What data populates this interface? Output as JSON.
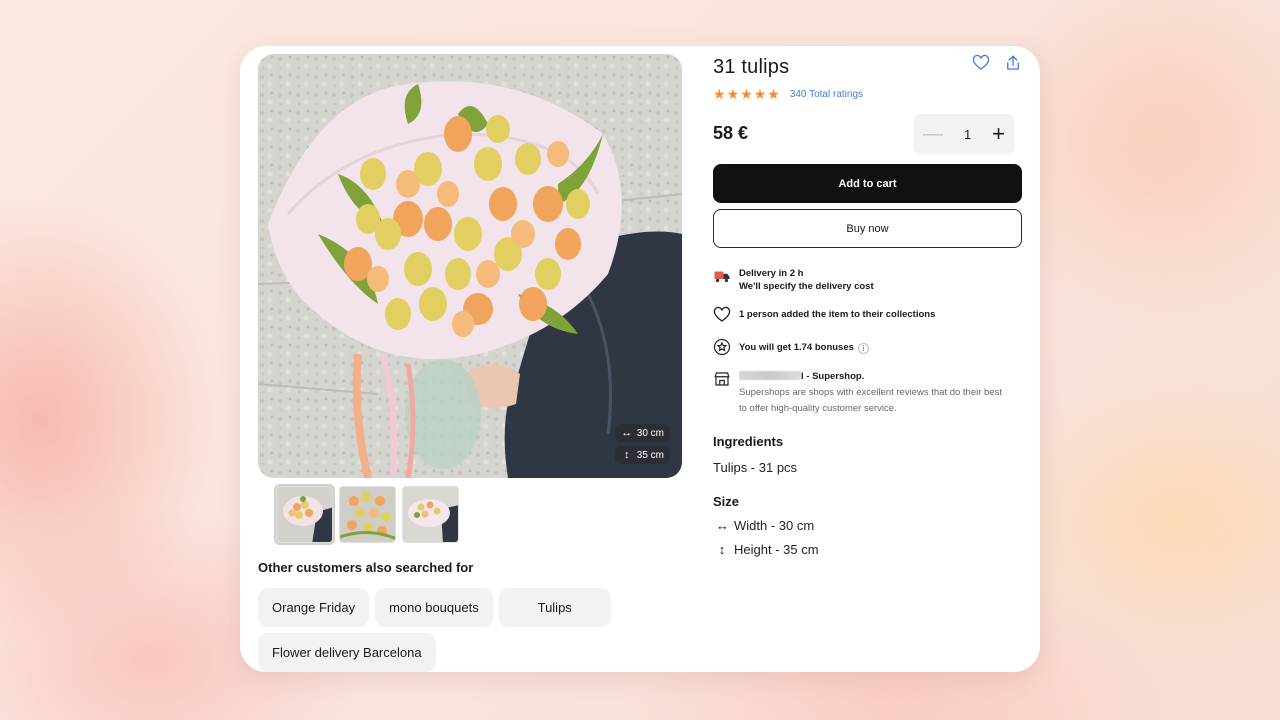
{
  "product": {
    "title": "31 tulips",
    "rating_value": 5,
    "ratings_text": "340 Total ratings",
    "price": "58 €",
    "quantity": "1",
    "add_to_cart": "Add to cart",
    "buy_now": "Buy now"
  },
  "image": {
    "width_badge": "30 cm",
    "height_badge": "35 cm",
    "thumbnail_count": 3
  },
  "info": {
    "delivery_title": "Delivery in 2 h",
    "delivery_sub": "We'll specify the delivery cost",
    "collections": "1 person added the item to their collections",
    "bonuses": "You will get 1.74 bonuses",
    "shop_suffix": "l - Supershop.",
    "shop_desc_1": "Supershops are shops with excellent reviews that do their best",
    "shop_desc_2": "to offer high-quality customer service."
  },
  "ingredients": {
    "title": "Ingredients",
    "text": "Tulips - 31 pcs"
  },
  "size": {
    "title": "Size",
    "width": "Width - 30 cm",
    "height": "Height - 35 cm"
  },
  "searched": {
    "title": "Other customers also searched for",
    "chips": [
      "Orange Friday",
      "mono bouquets",
      "Tulips",
      "Flower delivery Barcelona"
    ]
  },
  "icons": {
    "favorite": "heart-icon",
    "share": "share-icon",
    "delivery": "delivery-truck-icon",
    "collections": "heart-outline-icon",
    "bonus": "star-badge-icon",
    "shop": "shop-icon",
    "info": "info-icon",
    "width": "horizontal-arrows-icon",
    "height": "vertical-arrows-icon"
  },
  "colors": {
    "accent_star": "#ff8a2b",
    "link": "#3f7fdc",
    "primary_button": "#111111"
  }
}
